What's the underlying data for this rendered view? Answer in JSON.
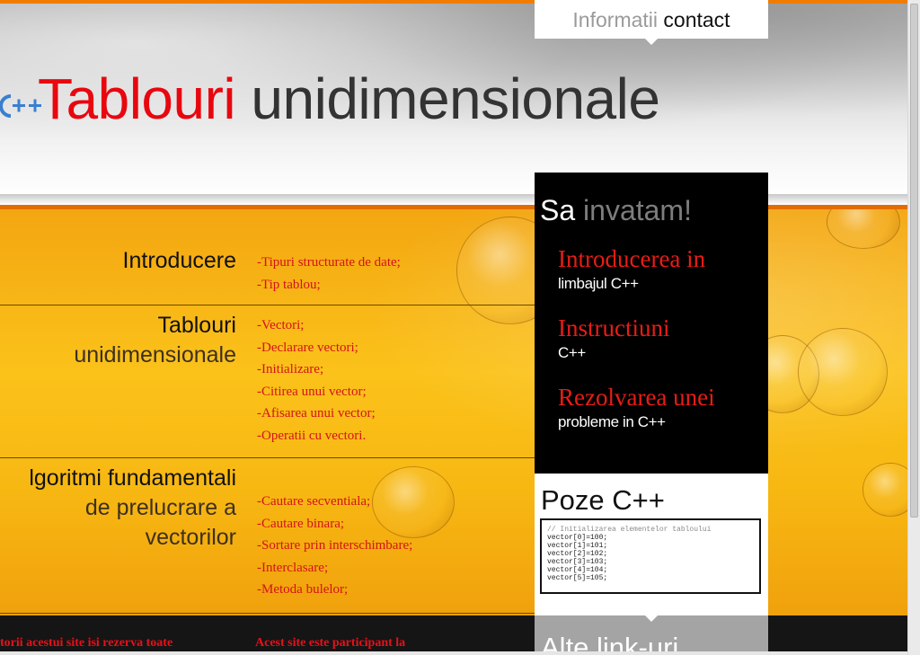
{
  "header": {
    "title_red": "Tablouri",
    "title_dark": "unidimensionale",
    "contact_grey": "Informatii",
    "contact_dark": "contact"
  },
  "sections": [
    {
      "title_lines": [
        "Introducere"
      ],
      "items": [
        "-Tipuri structurate de date;",
        "-Tip tablou;"
      ]
    },
    {
      "title_lines": [
        "Tablouri",
        "unidimensionale"
      ],
      "items": [
        "-Vectori;",
        "-Declarare vectori;",
        "-Initializare;",
        "-Citirea unui vector;",
        "-Afisarea unui vector;",
        "-Operatii cu vectori."
      ]
    },
    {
      "title_lines": [
        "lgoritmi fundamentali",
        "de prelucrare a",
        "vectorilor"
      ],
      "items": [
        "-Cautare secventiala;",
        "-Cautare binara;",
        "-Sortare prin interschimbare;",
        "-Interclasare;",
        "-Metoda bulelor;"
      ]
    }
  ],
  "sidebar": {
    "head_white": "Sa",
    "head_grey": "invatam!",
    "items": [
      {
        "title": "Introducerea in",
        "sub": "limbajul C++"
      },
      {
        "title": "Instructiuni",
        "sub": "C++"
      },
      {
        "title": "Rezolvarea unei",
        "sub": "probleme in C++"
      }
    ],
    "poze_title": "Poze C++",
    "code_lines": [
      "// Initializarea elementelor tabloului",
      "vector[0]=100;",
      "vector[1]=101;",
      "vector[2]=102;",
      "vector[3]=103;",
      "vector[4]=104;",
      "vector[5]=105;"
    ],
    "alte_title": "Alte link-uri"
  },
  "footer": {
    "left": "torii acestui site isi rezerva toate",
    "right": "Acest site este participant la"
  },
  "colors": {
    "accent_red": "#e8070f",
    "orange": "#f07d00",
    "dark": "#333333"
  }
}
